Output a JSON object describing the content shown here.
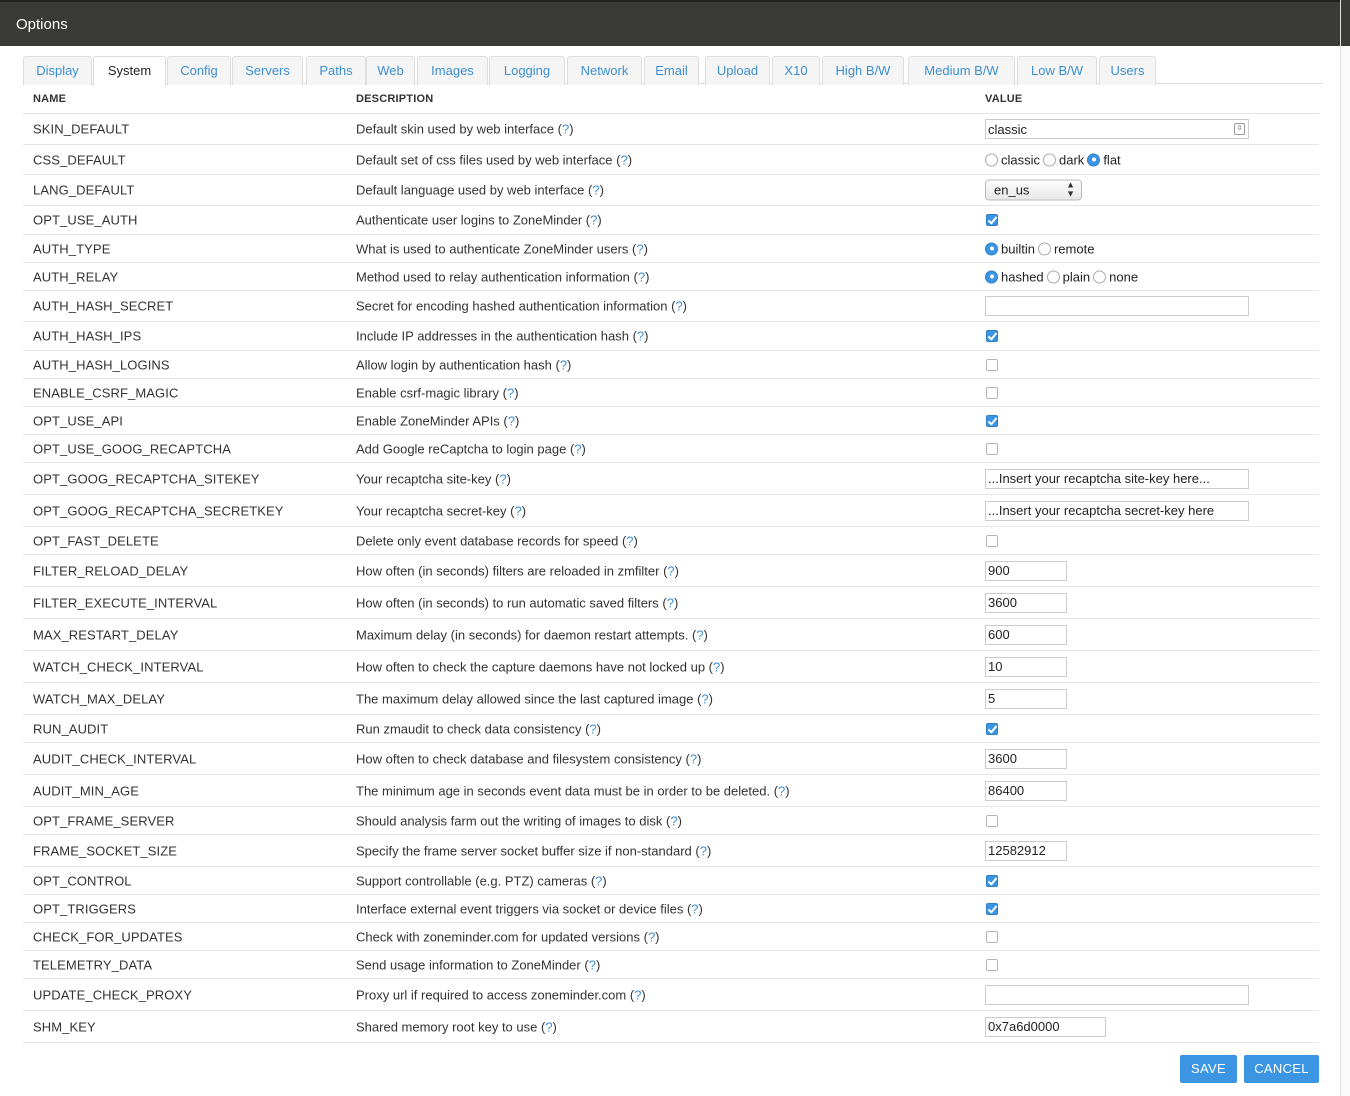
{
  "window": {
    "title": "Options"
  },
  "tabs": [
    {
      "label": "Display"
    },
    {
      "label": "System"
    },
    {
      "label": "Config"
    },
    {
      "label": "Servers"
    },
    {
      "label": "Paths"
    },
    {
      "label": "Web"
    },
    {
      "label": "Images"
    },
    {
      "label": "Logging"
    },
    {
      "label": "Network"
    },
    {
      "label": "Email"
    },
    {
      "label": "Upload"
    },
    {
      "label": "X10"
    },
    {
      "label": "High B/W"
    },
    {
      "label": "Medium B/W"
    },
    {
      "label": "Low B/W"
    },
    {
      "label": "Users"
    }
  ],
  "active_tab": "System",
  "table": {
    "headers": {
      "name": "NAME",
      "description": "DESCRIPTION",
      "value": "VALUE"
    },
    "help_label": "?",
    "rows": [
      {
        "name": "SKIN_DEFAULT",
        "desc": "Default skin used by web interface",
        "type": "select",
        "value": "classic"
      },
      {
        "name": "CSS_DEFAULT",
        "desc": "Default set of css files used by web interface",
        "type": "radio",
        "options": [
          "classic",
          "dark",
          "flat"
        ],
        "selected": "flat"
      },
      {
        "name": "LANG_DEFAULT",
        "desc": "Default language used by web interface",
        "type": "dropdown",
        "value": "en_us"
      },
      {
        "name": "OPT_USE_AUTH",
        "desc": "Authenticate user logins to ZoneMinder",
        "type": "checkbox",
        "checked": true
      },
      {
        "name": "AUTH_TYPE",
        "desc": "What is used to authenticate ZoneMinder users",
        "type": "radio",
        "options": [
          "builtin",
          "remote"
        ],
        "selected": "builtin"
      },
      {
        "name": "AUTH_RELAY",
        "desc": "Method used to relay authentication information",
        "type": "radio",
        "options": [
          "hashed",
          "plain",
          "none"
        ],
        "selected": "hashed"
      },
      {
        "name": "AUTH_HASH_SECRET",
        "desc": "Secret for encoding hashed authentication information",
        "type": "text",
        "value": "",
        "size": "long"
      },
      {
        "name": "AUTH_HASH_IPS",
        "desc": "Include IP addresses in the authentication hash",
        "type": "checkbox",
        "checked": true
      },
      {
        "name": "AUTH_HASH_LOGINS",
        "desc": "Allow login by authentication hash",
        "type": "checkbox",
        "checked": false
      },
      {
        "name": "ENABLE_CSRF_MAGIC",
        "desc": "Enable csrf-magic library",
        "type": "checkbox",
        "checked": false
      },
      {
        "name": "OPT_USE_API",
        "desc": "Enable ZoneMinder APIs",
        "type": "checkbox",
        "checked": true
      },
      {
        "name": "OPT_USE_GOOG_RECAPTCHA",
        "desc": "Add Google reCaptcha to login page",
        "type": "checkbox",
        "checked": false
      },
      {
        "name": "OPT_GOOG_RECAPTCHA_SITEKEY",
        "desc": "Your recaptcha site-key",
        "type": "text",
        "value": "...Insert your recaptcha site-key here...",
        "size": "long"
      },
      {
        "name": "OPT_GOOG_RECAPTCHA_SECRETKEY",
        "desc": "Your recaptcha secret-key",
        "type": "text",
        "value": "...Insert your recaptcha secret-key here",
        "size": "long"
      },
      {
        "name": "OPT_FAST_DELETE",
        "desc": "Delete only event database records for speed",
        "type": "checkbox",
        "checked": false
      },
      {
        "name": "FILTER_RELOAD_DELAY",
        "desc": "How often (in seconds) filters are reloaded in zmfilter",
        "type": "text",
        "value": "900",
        "size": "short"
      },
      {
        "name": "FILTER_EXECUTE_INTERVAL",
        "desc": "How often (in seconds) to run automatic saved filters",
        "type": "text",
        "value": "3600",
        "size": "short"
      },
      {
        "name": "MAX_RESTART_DELAY",
        "desc": "Maximum delay (in seconds) for daemon restart attempts.",
        "type": "text",
        "value": "600",
        "size": "short"
      },
      {
        "name": "WATCH_CHECK_INTERVAL",
        "desc": "How often to check the capture daemons have not locked up",
        "type": "text",
        "value": "10",
        "size": "short"
      },
      {
        "name": "WATCH_MAX_DELAY",
        "desc": "The maximum delay allowed since the last captured image",
        "type": "text",
        "value": "5",
        "size": "short"
      },
      {
        "name": "RUN_AUDIT",
        "desc": "Run zmaudit to check data consistency",
        "type": "checkbox",
        "checked": true
      },
      {
        "name": "AUDIT_CHECK_INTERVAL",
        "desc": "How often to check database and filesystem consistency",
        "type": "text",
        "value": "3600",
        "size": "short"
      },
      {
        "name": "AUDIT_MIN_AGE",
        "desc": "The minimum age in seconds event data must be in order to be deleted.",
        "type": "text",
        "value": "86400",
        "size": "short"
      },
      {
        "name": "OPT_FRAME_SERVER",
        "desc": "Should analysis farm out the writing of images to disk",
        "type": "checkbox",
        "checked": false
      },
      {
        "name": "FRAME_SOCKET_SIZE",
        "desc": "Specify the frame server socket buffer size if non-standard",
        "type": "text",
        "value": "12582912",
        "size": "short"
      },
      {
        "name": "OPT_CONTROL",
        "desc": "Support controllable (e.g. PTZ) cameras",
        "type": "checkbox",
        "checked": true
      },
      {
        "name": "OPT_TRIGGERS",
        "desc": "Interface external event triggers via socket or device files",
        "type": "checkbox",
        "checked": true
      },
      {
        "name": "CHECK_FOR_UPDATES",
        "desc": "Check with zoneminder.com for updated versions",
        "type": "checkbox",
        "checked": false
      },
      {
        "name": "TELEMETRY_DATA",
        "desc": "Send usage information to ZoneMinder",
        "type": "checkbox",
        "checked": false
      },
      {
        "name": "UPDATE_CHECK_PROXY",
        "desc": "Proxy url if required to access zoneminder.com",
        "type": "text",
        "value": "",
        "size": "long"
      },
      {
        "name": "SHM_KEY",
        "desc": "Shared memory root key to use",
        "type": "text",
        "value": "0x7a6d0000",
        "size": "medium"
      }
    ]
  },
  "buttons": {
    "save": "SAVE",
    "cancel": "CANCEL"
  },
  "colors": {
    "accent": "#3c95e3",
    "titlebar": "#3a3a38",
    "link": "#3d8fd0"
  }
}
